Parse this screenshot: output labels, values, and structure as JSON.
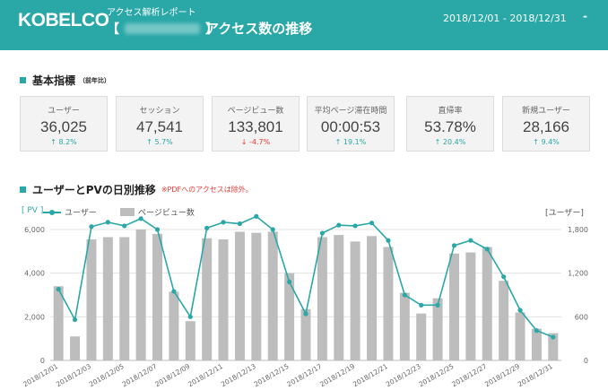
{
  "header": {
    "logo": "KOBELCO",
    "report_label": "アクセス解析レポート",
    "site_bracket_open": "【",
    "site_bracket_close": "】",
    "page_title": "アクセス数の推移",
    "date_range": "2018/12/01 - 2018/12/31",
    "menu_symbol": "-"
  },
  "kpi_section": {
    "title": "基本指標",
    "subtitle": "（前年比）"
  },
  "kpis": [
    {
      "label": "ユーザー",
      "value": "36,025",
      "change": "↑ 8.2%",
      "direction": "up"
    },
    {
      "label": "セッション",
      "value": "47,541",
      "change": "↑ 5.7%",
      "direction": "up"
    },
    {
      "label": "ページビュー数",
      "value": "133,801",
      "change": "↓ -4.7%",
      "direction": "down"
    },
    {
      "label": "平均ページ滞在時間",
      "value": "00:00:53",
      "change": "↑ 19.1%",
      "direction": "up"
    },
    {
      "label": "直帰率",
      "value": "53.78%",
      "change": "↑ 20.4%",
      "direction": "up"
    },
    {
      "label": "新規ユーザー",
      "value": "28,166",
      "change": "↑ 9.4%",
      "direction": "up"
    }
  ],
  "chart_section": {
    "title": "ユーザーとPVの日別推移",
    "note": "※PDFへのアクセスは除外。"
  },
  "colors": {
    "accent": "#2aa7a7",
    "bar": "#bdbdbd",
    "negative": "#e53935"
  },
  "chart_data": {
    "type": "bar",
    "legend": {
      "left_axis_label": "[ PV ]",
      "right_axis_label": "[ユーザー]",
      "line_name": "ユーザー",
      "bar_name": "ページビュー数",
      "placement": "top-left"
    },
    "categories": [
      "2018/12/01",
      "2018/12/02",
      "2018/12/03",
      "2018/12/04",
      "2018/12/05",
      "2018/12/06",
      "2018/12/07",
      "2018/12/08",
      "2018/12/09",
      "2018/12/10",
      "2018/12/11",
      "2018/12/12",
      "2018/12/13",
      "2018/12/14",
      "2018/12/15",
      "2018/12/16",
      "2018/12/17",
      "2018/12/18",
      "2018/12/19",
      "2018/12/20",
      "2018/12/21",
      "2018/12/22",
      "2018/12/23",
      "2018/12/24",
      "2018/12/25",
      "2018/12/26",
      "2018/12/27",
      "2018/12/28",
      "2018/12/29",
      "2018/12/30",
      "2018/12/31"
    ],
    "x_tick_labels": [
      "2018/12/01",
      "2018/12/03",
      "2018/12/05",
      "2018/12/07",
      "2018/12/09",
      "2018/12/11",
      "2018/12/13",
      "2018/12/15",
      "2018/12/17",
      "2018/12/19",
      "2018/12/21",
      "2018/12/23",
      "2018/12/25",
      "2018/12/27",
      "2018/12/29",
      "2018/12/31"
    ],
    "series": [
      {
        "name": "ページビュー数",
        "kind": "bar",
        "axis": "left",
        "values": [
          3400,
          1100,
          5550,
          5650,
          5650,
          6000,
          5800,
          3150,
          1800,
          5600,
          5550,
          5900,
          5850,
          5900,
          4000,
          2350,
          5650,
          5750,
          5450,
          5700,
          5200,
          3100,
          2150,
          2850,
          4900,
          4950,
          5200,
          3650,
          2200,
          1450,
          1250
        ]
      },
      {
        "name": "ユーザー",
        "kind": "line",
        "axis": "right",
        "values": [
          980,
          560,
          1840,
          1900,
          1850,
          1950,
          1800,
          950,
          600,
          1820,
          1900,
          1880,
          1980,
          1800,
          1080,
          640,
          1750,
          1860,
          1850,
          1890,
          1650,
          900,
          760,
          760,
          1580,
          1650,
          1530,
          1150,
          690,
          410,
          320
        ]
      }
    ],
    "y_left": {
      "range": [
        0,
        6000
      ],
      "ticks": [
        "0",
        "2,000",
        "4,000",
        "6,000"
      ]
    },
    "y_right": {
      "range": [
        0,
        1800
      ],
      "ticks": [
        "0",
        "600",
        "1,200",
        "1,800"
      ]
    },
    "grid": true
  }
}
